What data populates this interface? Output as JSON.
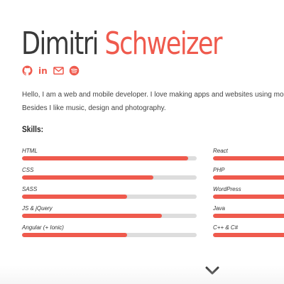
{
  "header": {
    "first_name": "Dimitri",
    "last_name": "Schweizer",
    "name_colors": {
      "first": "#3a3a3a",
      "last": "#ef5a4d"
    }
  },
  "social_links": [
    {
      "icon": "github-icon"
    },
    {
      "icon": "linkedin-icon",
      "text": "in"
    },
    {
      "icon": "email-icon"
    },
    {
      "icon": "spotify-icon"
    }
  ],
  "bio": {
    "line1": "Hello, I am a web and mobile developer. I love making apps and websites using modern tech",
    "line2": "Besides I like music, design and photography."
  },
  "skills": {
    "title": "Skills:",
    "accent": "#ef5a4d",
    "track": "#dddddd",
    "left": [
      {
        "label": "HTML",
        "level": 0.95
      },
      {
        "label": "CSS",
        "level": 0.75
      },
      {
        "label": "SASS",
        "level": 0.6
      },
      {
        "label": "JS & jQuery",
        "level": 0.8
      },
      {
        "label": "Angular (+ Ionic)",
        "level": 0.6
      }
    ],
    "right": [
      {
        "label": "React",
        "level": 0.6
      },
      {
        "label": "PHP",
        "level": 0.6
      },
      {
        "label": "WordPress",
        "level": 0.6
      },
      {
        "label": "Java",
        "level": 0.6
      },
      {
        "label": "C++ & C#",
        "level": 0.6
      }
    ]
  },
  "scroll_down": {
    "icon": "chevron-down-icon"
  }
}
